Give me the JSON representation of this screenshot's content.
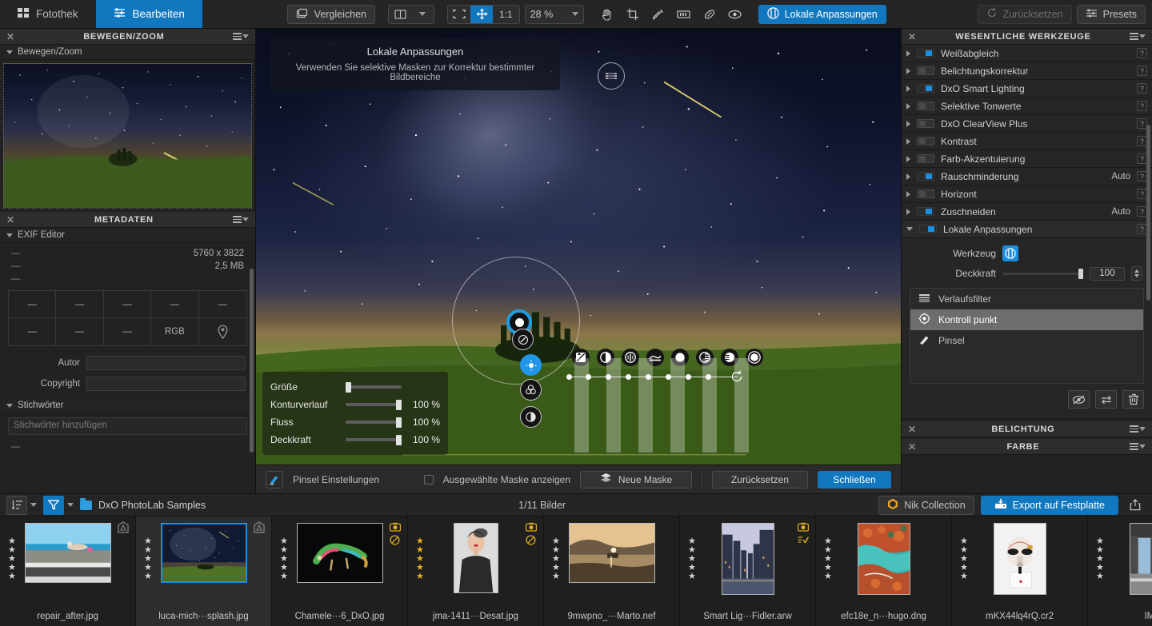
{
  "topbar": {
    "tabs": [
      {
        "label": "Fotothek",
        "icon": "grid-icon",
        "active": false
      },
      {
        "label": "Bearbeiten",
        "icon": "sliders-icon",
        "active": true
      }
    ],
    "compare_label": "Vergleichen",
    "compare_icon": "compare-icon",
    "view_mode_icon": "split-view-icon",
    "fit_icon": "fit-to-screen-icon",
    "pan_icon": "move-tool-icon",
    "ratio_label": "1:1",
    "zoom_value": "28 %",
    "tools": [
      "hand-icon",
      "crop-icon",
      "eyedropper-icon",
      "histogram-icon",
      "repair-icon",
      "eye-icon"
    ],
    "local_adjustments_label": "Lokale Anpassungen",
    "local_adjustments_icon": "local-adjustments-icon",
    "reset_label": "Zurücksetzen",
    "reset_icon": "reset-icon",
    "presets_label": "Presets",
    "presets_icon": "presets-icon",
    "accent_color": "#1178c0"
  },
  "left_panel": {
    "navigator": {
      "title": "BEWEGEN/ZOOM",
      "section_label": "Bewegen/Zoom",
      "close_icon": "close-icon",
      "menu_icon": "palette-menu-icon"
    },
    "metadata": {
      "title": "METADATEN",
      "close_icon": "close-icon",
      "menu_icon": "palette-menu-icon",
      "exif_section": "EXIF Editor",
      "rows": [
        {
          "label": "—",
          "value": "5760 x 3822"
        },
        {
          "label": "—",
          "value": "2,5 MB"
        },
        {
          "label": "—",
          "value": ""
        }
      ],
      "grid": [
        "—",
        "—",
        "—",
        "—",
        "—",
        "—",
        "—",
        "—",
        "RGB",
        "location-pin-icon"
      ],
      "author_label": "Autor",
      "author_value": "",
      "copyright_label": "Copyright",
      "copyright_value": "",
      "keywords_section": "Stichwörter",
      "keywords_placeholder": "Stichwörter hinzufügen",
      "trailing_dash": "—"
    }
  },
  "right_panel": {
    "title": "WESENTLICHE WERKZEUGE",
    "close_icon": "close-icon",
    "menu_icon": "palette-menu-icon",
    "tools": [
      {
        "label": "Weißabgleich",
        "enabled": true,
        "auto": ""
      },
      {
        "label": "Belichtungskorrektur",
        "enabled": false,
        "auto": ""
      },
      {
        "label": "DxO Smart Lighting",
        "enabled": true,
        "auto": ""
      },
      {
        "label": "Selektive Tonwerte",
        "enabled": false,
        "auto": ""
      },
      {
        "label": "DxO ClearView Plus",
        "enabled": false,
        "auto": ""
      },
      {
        "label": "Kontrast",
        "enabled": false,
        "auto": ""
      },
      {
        "label": "Farb-Akzentuierung",
        "enabled": false,
        "auto": ""
      },
      {
        "label": "Rauschminderung",
        "enabled": true,
        "auto": "Auto"
      },
      {
        "label": "Horizont",
        "enabled": false,
        "auto": ""
      },
      {
        "label": "Zuschneiden",
        "enabled": true,
        "auto": "Auto"
      }
    ],
    "help_icon": "help-icon",
    "local_adjustments": {
      "label": "Lokale Anpassungen",
      "enabled": true,
      "tool_label": "Werkzeug",
      "tool_icon": "local-adjustments-icon",
      "opacity_label": "Deckkraft",
      "opacity_value": "100",
      "mask_types": [
        {
          "label": "Verlaufsfilter",
          "icon": "gradient-filter-icon",
          "selected": false
        },
        {
          "label": "Kontroll punkt",
          "icon": "control-point-icon",
          "selected": true
        },
        {
          "label": "Pinsel",
          "icon": "brush-icon",
          "selected": false
        }
      ],
      "actions": [
        {
          "icon": "hide-mask-icon"
        },
        {
          "icon": "invert-mask-icon"
        },
        {
          "icon": "delete-mask-icon"
        }
      ]
    },
    "collapsed_palettes": [
      {
        "title": "BELICHTUNG",
        "close_icon": "close-icon",
        "menu_icon": "palette-menu-icon"
      },
      {
        "title": "FARBE",
        "close_icon": "close-icon",
        "menu_icon": "palette-menu-icon"
      }
    ]
  },
  "viewer": {
    "hint_title": "Lokale Anpassungen",
    "hint_text": "Verwenden Sie selektive Masken zur Korrektur bestimmter Bildbereiche",
    "compass_icon": "horizon-compass-icon",
    "brush_panel": {
      "rows": [
        {
          "label": "Größe",
          "value": "",
          "pos": 0
        },
        {
          "label": "Konturverlauf",
          "value": "100 %",
          "pos": 100
        },
        {
          "label": "Fluss",
          "value": "100 %",
          "pos": 100
        },
        {
          "label": "Deckkraft",
          "value": "100 %",
          "pos": 100
        }
      ]
    },
    "control_point": {
      "equalizer_icons": [
        "exposure-icon",
        "contrast-icon",
        "microcontrast-icon",
        "hue-icon",
        "saturation-icon",
        "vibrance-icon",
        "warmth-icon",
        "tint-icon"
      ],
      "reset_icon": "cp-reset-icon",
      "sub_icons": [
        "cp-move-icon",
        "cp-brightness-icon",
        "cp-color-icon",
        "cp-opacity-icon"
      ]
    },
    "bottom_bar": {
      "brush_settings_label": "Pinsel Einstellungen",
      "brush_settings_icon": "brush-settings-icon",
      "show_mask_label": "Ausgewählte Maske anzeigen",
      "show_mask_checked": false,
      "new_mask_label": "Neue Maske",
      "new_mask_icon": "layers-icon",
      "reset_label": "Zurücksetzen",
      "close_label": "Schließen"
    }
  },
  "bottom_bar": {
    "sort_icon": "sort-icon",
    "filter_icon": "filter-icon",
    "folder_icon": "folder-icon",
    "folder_label": "DxO PhotoLab Samples",
    "counter": "1/11 Bilder",
    "nik_label": "Nik Collection",
    "nik_icon": "nik-icon",
    "export_label": "Export auf Festplatte",
    "export_icon": "export-icon",
    "share_icon": "share-icon"
  },
  "filmstrip": {
    "items": [
      {
        "filename": "repair_after.jpg",
        "stars": 5,
        "gold": false,
        "selected": false,
        "badges": [
          "warning-icon"
        ],
        "orient": "landscape"
      },
      {
        "filename": "luca-mich···splash.jpg",
        "stars": 5,
        "gold": false,
        "selected": true,
        "badges": [
          "warning-icon"
        ],
        "orient": "landscape"
      },
      {
        "filename": "Chamele···6_DxO.jpg",
        "stars": 5,
        "gold": false,
        "selected": false,
        "badges": [
          "camera-icon",
          "no-icon"
        ],
        "orient": "landscape"
      },
      {
        "filename": "jma-1411···Desat.jpg",
        "stars": 5,
        "gold": true,
        "selected": false,
        "badges": [
          "camera-icon",
          "no-icon"
        ],
        "orient": "portrait"
      },
      {
        "filename": "9mwpno_···Marto.nef",
        "stars": 5,
        "gold": false,
        "selected": false,
        "badges": [],
        "orient": "landscape"
      },
      {
        "filename": "Smart Lig···Fidler.arw",
        "stars": 5,
        "gold": false,
        "selected": false,
        "badges": [
          "camera-icon",
          "check-icon"
        ],
        "orient": "tall"
      },
      {
        "filename": "efc18e_n···hugo.dng",
        "stars": 5,
        "gold": false,
        "selected": false,
        "badges": [],
        "orient": "tall"
      },
      {
        "filename": "mKX44lq4rQ.cr2",
        "stars": 5,
        "gold": false,
        "selected": false,
        "badges": [],
        "orient": "tall"
      },
      {
        "filename": "IMG_",
        "stars": 5,
        "gold": false,
        "selected": false,
        "badges": [],
        "orient": "tall"
      }
    ]
  }
}
